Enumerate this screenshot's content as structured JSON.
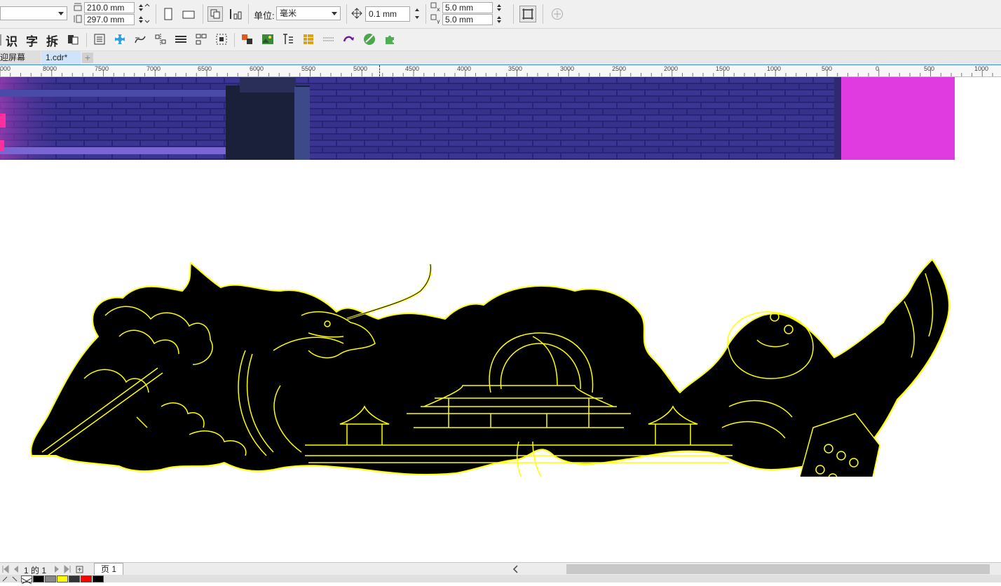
{
  "property_bar": {
    "width_value": "210.0 mm",
    "height_value": "297.0 mm",
    "unit_label": "单位:",
    "unit_value": "毫米",
    "nudge_value": "0.1 mm",
    "dup_x_value": "5.0 mm",
    "dup_y_value": "5.0 mm"
  },
  "toolbar": {
    "char1": "识",
    "char2": "字",
    "char3": "拆"
  },
  "tabs": [
    {
      "label": "迎屏幕",
      "active": false
    },
    {
      "label": "1.cdr*",
      "active": true
    }
  ],
  "ruler": {
    "labels": [
      "000",
      "8000",
      "7500",
      "7000",
      "6500",
      "6000",
      "5500",
      "5000",
      "4500",
      "4000",
      "3500",
      "3000",
      "2500",
      "2000",
      "1500",
      "1000",
      "500",
      "0",
      "500",
      "1000"
    ]
  },
  "page_nav": {
    "page_count_text": "1 的 1",
    "page_tab": "页 1"
  },
  "palette": {
    "colors": [
      "#000000",
      "#888888",
      "#ffff00",
      "#333333",
      "#ff0000",
      "#000000"
    ]
  },
  "colors": {
    "artwork_fill": "#000000",
    "artwork_outline": "#ffff00",
    "photo_magenta": "#e03be0",
    "photo_brick": "#3a2f8c"
  }
}
